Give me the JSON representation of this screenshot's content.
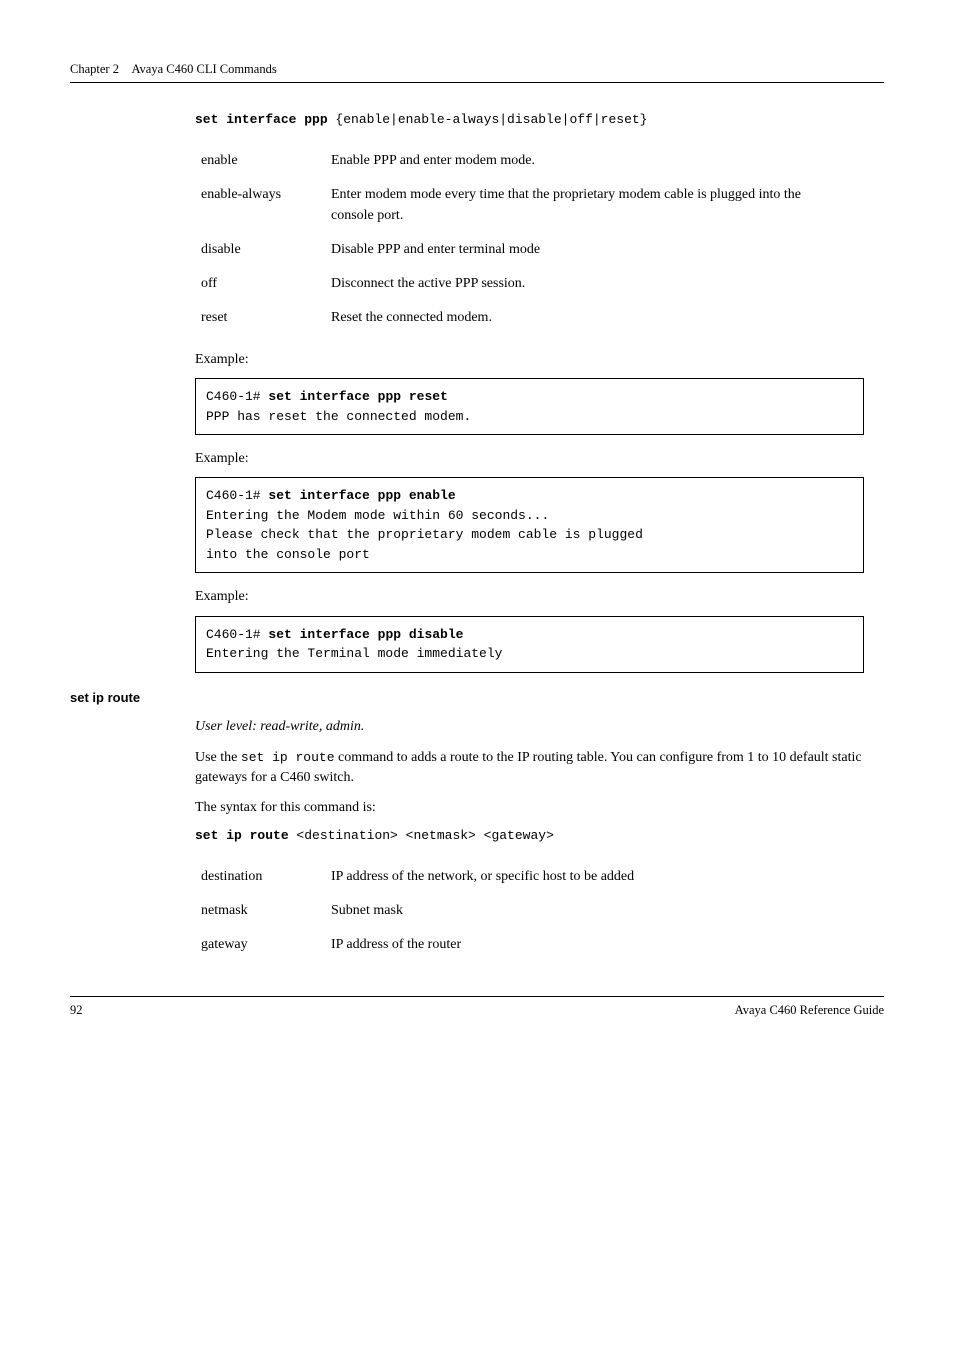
{
  "header": {
    "chapter": "Chapter 2",
    "title": "Avaya C460 CLI Commands"
  },
  "cmd1": {
    "syntax_bold": "set interface ppp",
    "syntax_rest": " {enable|enable-always|disable|off|reset}",
    "params": [
      {
        "name": "enable",
        "desc": "Enable PPP and enter modem mode."
      },
      {
        "name": "enable-always",
        "desc": "Enter modem mode every time that the proprietary modem cable is plugged into the console port."
      },
      {
        "name": "disable",
        "desc": "Disable PPP and enter terminal mode"
      },
      {
        "name": "off",
        "desc": "Disconnect the active PPP session."
      },
      {
        "name": "reset",
        "desc": "Reset the connected modem."
      }
    ],
    "example_label": "Example:",
    "ex1_prompt": "C460-1# ",
    "ex1_cmd": "set interface ppp reset",
    "ex1_out": "PPP has reset the connected modem.",
    "ex2_prompt": "C460-1# ",
    "ex2_cmd": "set interface ppp enable",
    "ex2_out": "Entering the Modem mode within 60 seconds...\nPlease check that the proprietary modem cable is plugged \ninto the console port",
    "ex3_prompt": "C460-1# ",
    "ex3_cmd": "set interface ppp disable",
    "ex3_out": "Entering the Terminal mode immediately"
  },
  "cmd2": {
    "heading": "set ip route",
    "user_level": "User level: read-write, admin.",
    "desc_pre": "Use the ",
    "desc_code": "set ip route",
    "desc_post": " command to adds a route to the IP routing table. You can configure from 1 to 10 default static gateways for a C460 switch.",
    "syntax_label": "The syntax for this command is:",
    "syntax_bold": "set ip route",
    "syntax_rest": " <destination> <netmask> <gateway>",
    "params": [
      {
        "name": "destination",
        "desc": "IP address of the network, or specific host to be added"
      },
      {
        "name": "netmask",
        "desc": "Subnet mask"
      },
      {
        "name": "gateway",
        "desc": "IP address of the router"
      }
    ]
  },
  "footer": {
    "page": "92",
    "doc": "Avaya C460 Reference Guide"
  }
}
